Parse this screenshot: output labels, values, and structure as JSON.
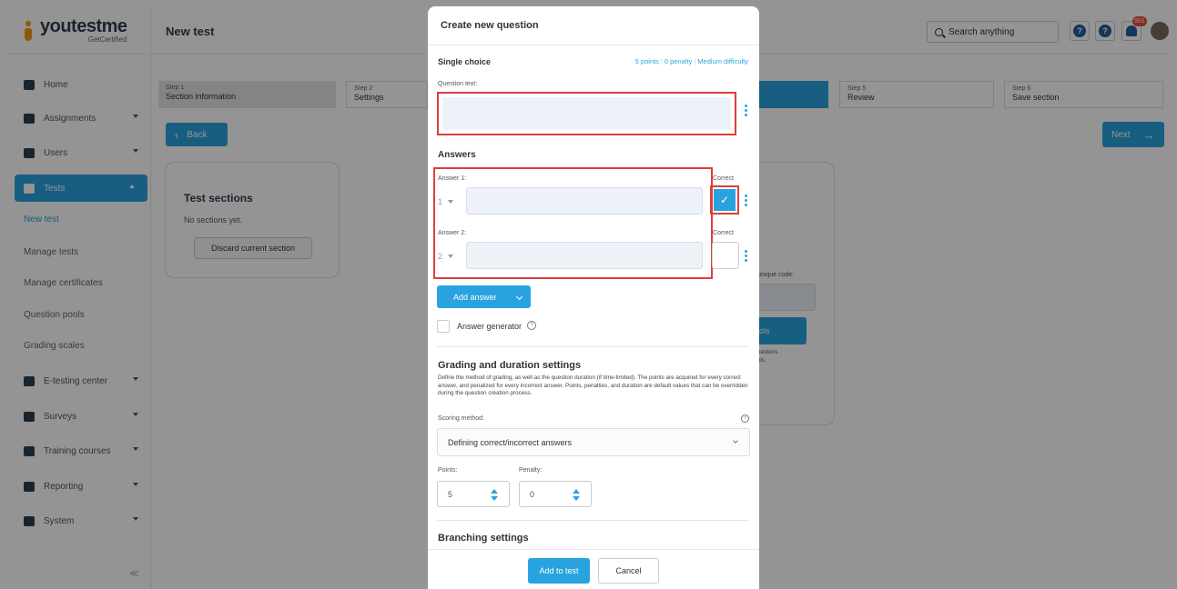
{
  "app": {
    "brand_main": "youtestme",
    "brand_sub": "GetCertified",
    "page_title": "New test"
  },
  "sidebar": {
    "items": [
      {
        "label": "Home",
        "icon": "home-icon"
      },
      {
        "label": "Assignments",
        "icon": "assignments-icon"
      },
      {
        "label": "Users",
        "icon": "users-icon"
      },
      {
        "label": "Tests",
        "icon": "tests-icon",
        "active": true
      },
      {
        "label": "E-testing center",
        "icon": "e-testing-icon"
      },
      {
        "label": "Surveys",
        "icon": "surveys-icon"
      },
      {
        "label": "Training courses",
        "icon": "training-icon"
      },
      {
        "label": "Reporting",
        "icon": "reporting-icon"
      },
      {
        "label": "System",
        "icon": "system-icon"
      }
    ],
    "sub_items": [
      "New test",
      "Manage tests",
      "Manage certificates",
      "Question pools",
      "Grading scales"
    ],
    "collapse_label": "≪"
  },
  "header": {
    "search_placeholder": "Search anything",
    "notification_count": "501",
    "help_label": "?",
    "support_label": "?"
  },
  "steps": [
    {
      "num": "Step 1",
      "label": "Section information"
    },
    {
      "num": "Step 2",
      "label": "Settings"
    },
    {
      "num": "Step 5",
      "label": "Review"
    },
    {
      "num": "Step 6",
      "label": "Save section"
    }
  ],
  "nav": {
    "back_label": "Back",
    "next_label": "Next"
  },
  "sections_card": {
    "title": "Test sections",
    "empty_text": "No sections yet.",
    "discard_label": "Discard current section"
  },
  "right_card": {
    "code_label": "unique code:",
    "button_label": "ols",
    "text_line1": "uestions",
    "text_line2": "ols."
  },
  "modal": {
    "title": "Create new question",
    "question_type": "Single choice",
    "meta": {
      "points": "5 points",
      "penalty": "0 penalty",
      "difficulty": "Medium difficulty"
    },
    "question_text_label": "Question text:",
    "answers_heading": "Answers",
    "answers": [
      {
        "label": "Answer 1:",
        "number": "1",
        "correct_label": "Correct",
        "correct": true
      },
      {
        "label": "Answer 2:",
        "number": "2",
        "correct_label": "Correct",
        "correct": false
      }
    ],
    "add_answer_label": "Add answer",
    "answer_generator_label": "Answer generator",
    "grading": {
      "title": "Grading and duration settings",
      "description": "Define the method of grading, as well as the question duration (if time-limited). The points are acquired for every correct answer, and penalized for every incorrect answer. Points, penalties, and duration are default values that can be overridden during the question creation process.",
      "scoring_label": "Scoring method:",
      "scoring_value": "Defining correct/incorrect answers",
      "points_label": "Points:",
      "points_value": "5",
      "penalty_label": "Penalty:",
      "penalty_value": "0"
    },
    "branching_title": "Branching settings",
    "add_to_test_label": "Add to test",
    "cancel_label": "Cancel"
  },
  "colors": {
    "accent": "#29a3df",
    "highlight": "#e03c3c",
    "brand_orange": "#f39c12"
  }
}
